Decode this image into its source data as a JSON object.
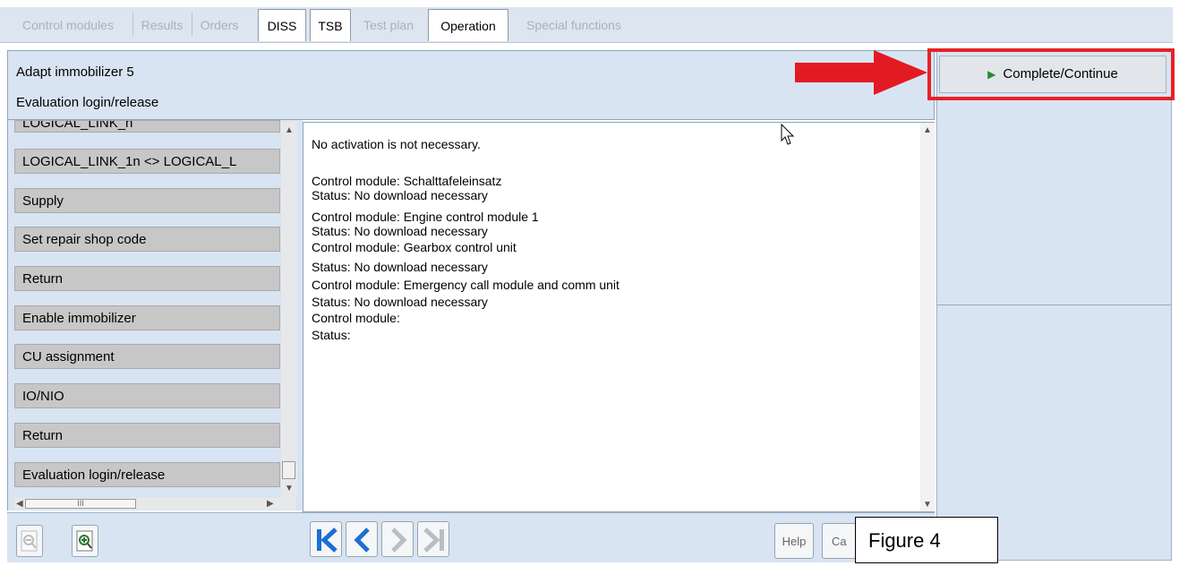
{
  "tabs": [
    {
      "label": "Control modules",
      "state": "disabled"
    },
    {
      "label": "Results",
      "state": "disabled"
    },
    {
      "label": "Orders",
      "state": "disabled"
    },
    {
      "label": "DISS",
      "state": "enabled"
    },
    {
      "label": "TSB",
      "state": "enabled"
    },
    {
      "label": "Test plan",
      "state": "disabled"
    },
    {
      "label": "Operation",
      "state": "enabled"
    },
    {
      "label": "Special functions",
      "state": "disabled"
    }
  ],
  "header": {
    "title": "Adapt immobilizer 5",
    "subtitle": "Evaluation login/release"
  },
  "right_panel": {
    "complete_button": "Complete/Continue",
    "highlight_color": "#e62227"
  },
  "steps": [
    "LOGICAL_LINK_n",
    "LOGICAL_LINK_1n <> LOGICAL_L",
    "Supply",
    "Set repair shop code",
    "Return",
    "Enable immobilizer",
    "CU assignment",
    "IO/NIO",
    "Return",
    "Evaluation login/release"
  ],
  "main_text": {
    "intro": "No activation is not necessary.",
    "lines": [
      "Control module: Schalttafeleinsatz",
      "Status: No download necessary",
      "Control module: Engine control module 1",
      "Status: No download necessary",
      "Control module: Gearbox control unit",
      "Status: No download necessary",
      "Control module: Emergency call module and comm unit",
      "Status: No download necessary",
      "Control module:",
      "Status:"
    ]
  },
  "bottom": {
    "help_label": "Help",
    "cancel_label": "Ca",
    "figure_label": "Figure 4",
    "scroll_marker": "III"
  },
  "colors": {
    "panel_bg": "#d9e4f2",
    "step_bg": "#c7c7c7",
    "nav_blue": "#1d6fd0"
  }
}
